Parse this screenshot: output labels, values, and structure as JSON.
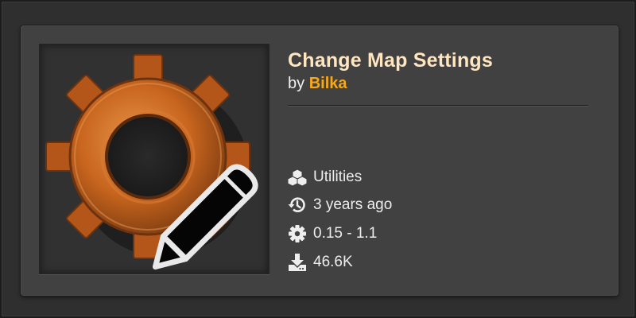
{
  "mod": {
    "title": "Change Map Settings",
    "by_label": "by",
    "author": "Bilka",
    "thumbnail_icon": "gear-pencil-icon"
  },
  "meta": {
    "category": {
      "icon": "cubes-icon",
      "label": "Utilities"
    },
    "updated": {
      "icon": "history-icon",
      "label": "3 years ago"
    },
    "versions": {
      "icon": "gear-icon",
      "label": "0.15 - 1.1"
    },
    "downloads": {
      "icon": "download-icon",
      "label": "46.6K"
    }
  },
  "colors": {
    "title": "#ffe6c0",
    "author": "#f5a818",
    "card_bg": "#414141",
    "gear": "#c8651e"
  }
}
